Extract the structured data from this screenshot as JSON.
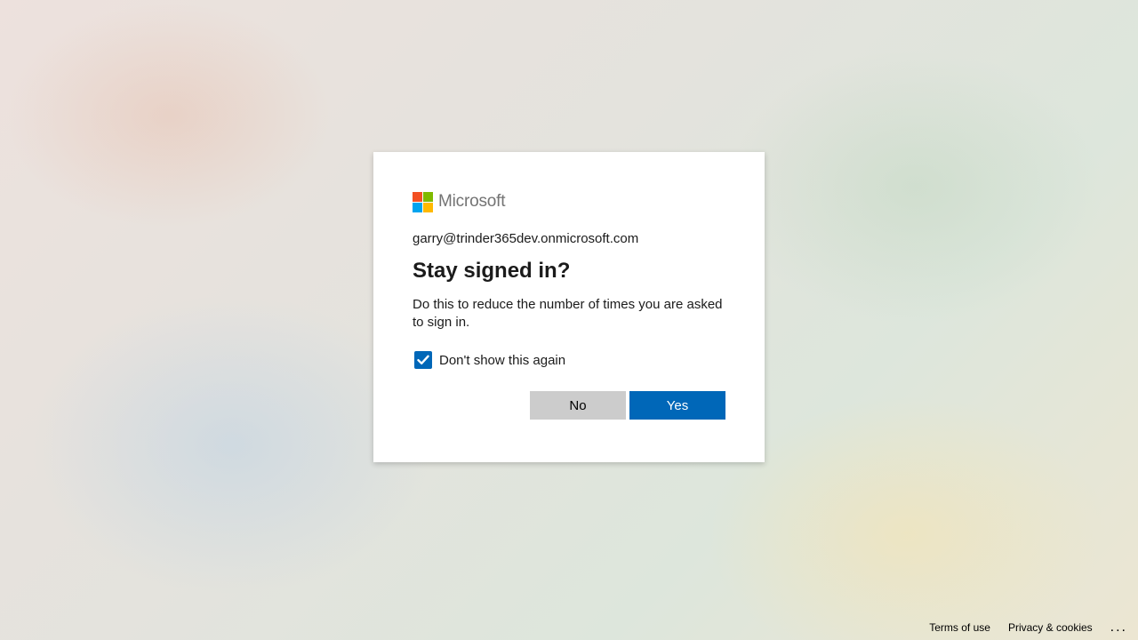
{
  "brand": {
    "name": "Microsoft",
    "logo_colors": [
      "#f25022",
      "#7fba00",
      "#00a4ef",
      "#ffb900"
    ]
  },
  "dialog": {
    "identity": "garry@trinder365dev.onmicrosoft.com",
    "title": "Stay signed in?",
    "description": "Do this to reduce the number of times you are asked to sign in.",
    "checkbox_label": "Don't show this again",
    "checkbox_checked": true,
    "no_label": "No",
    "yes_label": "Yes"
  },
  "colors": {
    "accent": "#0067b8",
    "secondary_button": "#cccccc"
  },
  "footer": {
    "terms_label": "Terms of use",
    "privacy_label": "Privacy & cookies",
    "more_label": "..."
  }
}
